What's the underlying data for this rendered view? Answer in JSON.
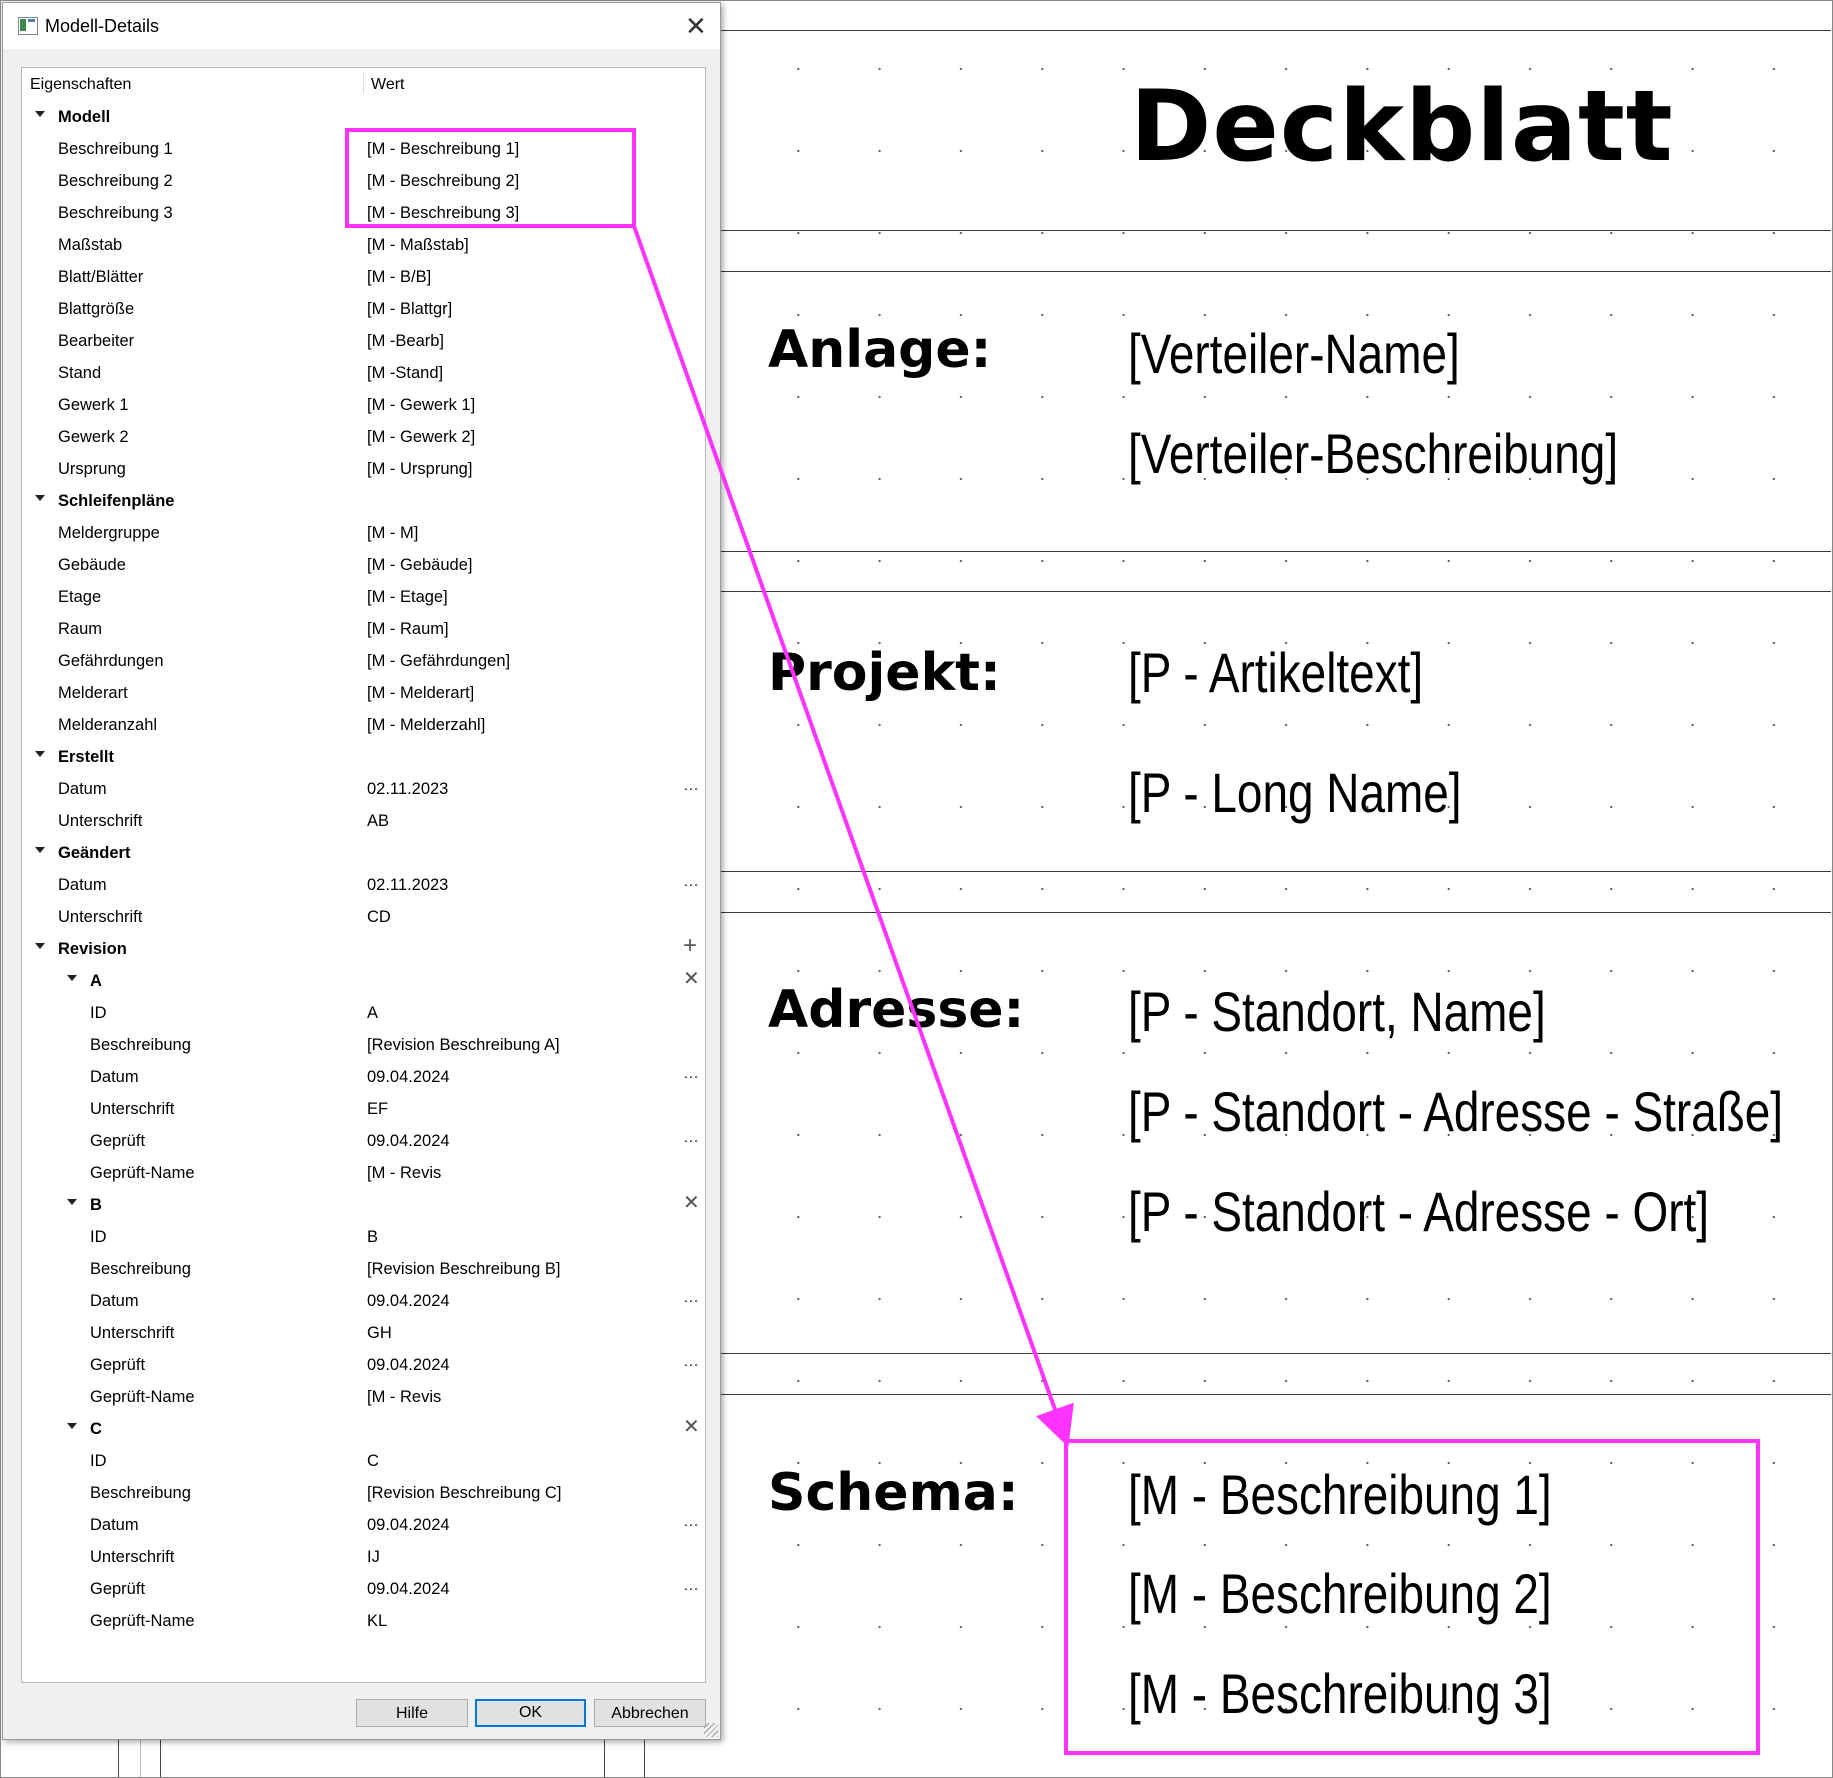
{
  "dialog": {
    "title": "Modell-Details",
    "columns": {
      "property": "Eigenschaften",
      "value": "Wert"
    },
    "buttons": {
      "help": "Hilfe",
      "ok": "OK",
      "cancel": "Abbrechen"
    },
    "rows": [
      {
        "type": "cat",
        "level": 0,
        "label": "Modell"
      },
      {
        "type": "prop",
        "level": 0,
        "label": "Beschreibung 1",
        "value": "[M - Beschreibung 1]"
      },
      {
        "type": "prop",
        "level": 0,
        "label": "Beschreibung 2",
        "value": "[M - Beschreibung 2]"
      },
      {
        "type": "prop",
        "level": 0,
        "label": "Beschreibung 3",
        "value": "[M - Beschreibung 3]"
      },
      {
        "type": "prop",
        "level": 0,
        "label": "Maßstab",
        "value": "[M - Maßstab]"
      },
      {
        "type": "prop",
        "level": 0,
        "label": "Blatt/Blätter",
        "value": "[M - B/B]"
      },
      {
        "type": "prop",
        "level": 0,
        "label": "Blattgröße",
        "value": "[M - Blattgr]"
      },
      {
        "type": "prop",
        "level": 0,
        "label": "Bearbeiter",
        "value": "[M -Bearb]"
      },
      {
        "type": "prop",
        "level": 0,
        "label": "Stand",
        "value": "[M -Stand]"
      },
      {
        "type": "prop",
        "level": 0,
        "label": "Gewerk 1",
        "value": "[M - Gewerk 1]"
      },
      {
        "type": "prop",
        "level": 0,
        "label": "Gewerk 2",
        "value": "[M - Gewerk 2]"
      },
      {
        "type": "prop",
        "level": 0,
        "label": "Ursprung",
        "value": "[M - Ursprung]"
      },
      {
        "type": "cat",
        "level": 0,
        "label": "Schleifenpläne"
      },
      {
        "type": "prop",
        "level": 0,
        "label": "Meldergruppe",
        "value": "[M - M]"
      },
      {
        "type": "prop",
        "level": 0,
        "label": "Gebäude",
        "value": "[M - Gebäude]"
      },
      {
        "type": "prop",
        "level": 0,
        "label": "Etage",
        "value": "[M - Etage]"
      },
      {
        "type": "prop",
        "level": 0,
        "label": "Raum",
        "value": "[M - Raum]"
      },
      {
        "type": "prop",
        "level": 0,
        "label": "Gefährdungen",
        "value": "[M - Gefährdungen]"
      },
      {
        "type": "prop",
        "level": 0,
        "label": "Melderart",
        "value": "[M - Melderart]"
      },
      {
        "type": "prop",
        "level": 0,
        "label": "Melderanzahl",
        "value": "[M - Melderzahl]"
      },
      {
        "type": "cat",
        "level": 0,
        "label": "Erstellt"
      },
      {
        "type": "prop",
        "level": 0,
        "label": "Datum",
        "value": "02.11.2023",
        "action": "dots"
      },
      {
        "type": "prop",
        "level": 0,
        "label": "Unterschrift",
        "value": "AB"
      },
      {
        "type": "cat",
        "level": 0,
        "label": "Geändert"
      },
      {
        "type": "prop",
        "level": 0,
        "label": "Datum",
        "value": "02.11.2023",
        "action": "dots"
      },
      {
        "type": "prop",
        "level": 0,
        "label": "Unterschrift",
        "value": "CD"
      },
      {
        "type": "cat",
        "level": 0,
        "label": "Revision",
        "action": "plus"
      },
      {
        "type": "cat",
        "level": 1,
        "label": "A",
        "action": "remove"
      },
      {
        "type": "prop",
        "level": 1,
        "label": "ID",
        "value": "A"
      },
      {
        "type": "prop",
        "level": 1,
        "label": "Beschreibung",
        "value": "[Revision Beschreibung A]"
      },
      {
        "type": "prop",
        "level": 1,
        "label": "Datum",
        "value": "09.04.2024",
        "action": "dots"
      },
      {
        "type": "prop",
        "level": 1,
        "label": "Unterschrift",
        "value": "EF"
      },
      {
        "type": "prop",
        "level": 1,
        "label": "Geprüft",
        "value": "09.04.2024",
        "action": "dots"
      },
      {
        "type": "prop",
        "level": 1,
        "label": "Geprüft-Name",
        "value": "[M - Revis"
      },
      {
        "type": "cat",
        "level": 1,
        "label": "B",
        "action": "remove"
      },
      {
        "type": "prop",
        "level": 1,
        "label": "ID",
        "value": "B"
      },
      {
        "type": "prop",
        "level": 1,
        "label": "Beschreibung",
        "value": "[Revision Beschreibung B]"
      },
      {
        "type": "prop",
        "level": 1,
        "label": "Datum",
        "value": "09.04.2024",
        "action": "dots"
      },
      {
        "type": "prop",
        "level": 1,
        "label": "Unterschrift",
        "value": "GH"
      },
      {
        "type": "prop",
        "level": 1,
        "label": "Geprüft",
        "value": "09.04.2024",
        "action": "dots"
      },
      {
        "type": "prop",
        "level": 1,
        "label": "Geprüft-Name",
        "value": "[M - Revis"
      },
      {
        "type": "cat",
        "level": 1,
        "label": "C",
        "action": "remove"
      },
      {
        "type": "prop",
        "level": 1,
        "label": "ID",
        "value": "C"
      },
      {
        "type": "prop",
        "level": 1,
        "label": "Beschreibung",
        "value": "[Revision Beschreibung C]"
      },
      {
        "type": "prop",
        "level": 1,
        "label": "Datum",
        "value": "09.04.2024",
        "action": "dots"
      },
      {
        "type": "prop",
        "level": 1,
        "label": "Unterschrift",
        "value": "IJ"
      },
      {
        "type": "prop",
        "level": 1,
        "label": "Geprüft",
        "value": "09.04.2024",
        "action": "dots"
      },
      {
        "type": "prop",
        "level": 1,
        "label": "Geprüft-Name",
        "value": "KL"
      }
    ]
  },
  "sheet": {
    "title": "Deckblatt",
    "sections": {
      "anlage": {
        "label": "Anlage:",
        "values": [
          "[Verteiler-Name]",
          "[Verteiler-Beschreibung]"
        ]
      },
      "projekt": {
        "label": "Projekt:",
        "values": [
          "[P - Artikeltext]",
          "[P - Long Name]"
        ]
      },
      "adresse": {
        "label": "Adresse:",
        "values": [
          "[P - Standort, Name]",
          "[P - Standort - Adresse - Straße]",
          "[P - Standort - Adresse - Ort]"
        ]
      },
      "schema": {
        "label": "Schema:",
        "values": [
          "[M - Beschreibung 1]",
          "[M - Beschreibung 2]",
          "[M - Beschreibung 3]"
        ]
      }
    }
  },
  "annotation": {
    "color": "#ff33ff"
  }
}
